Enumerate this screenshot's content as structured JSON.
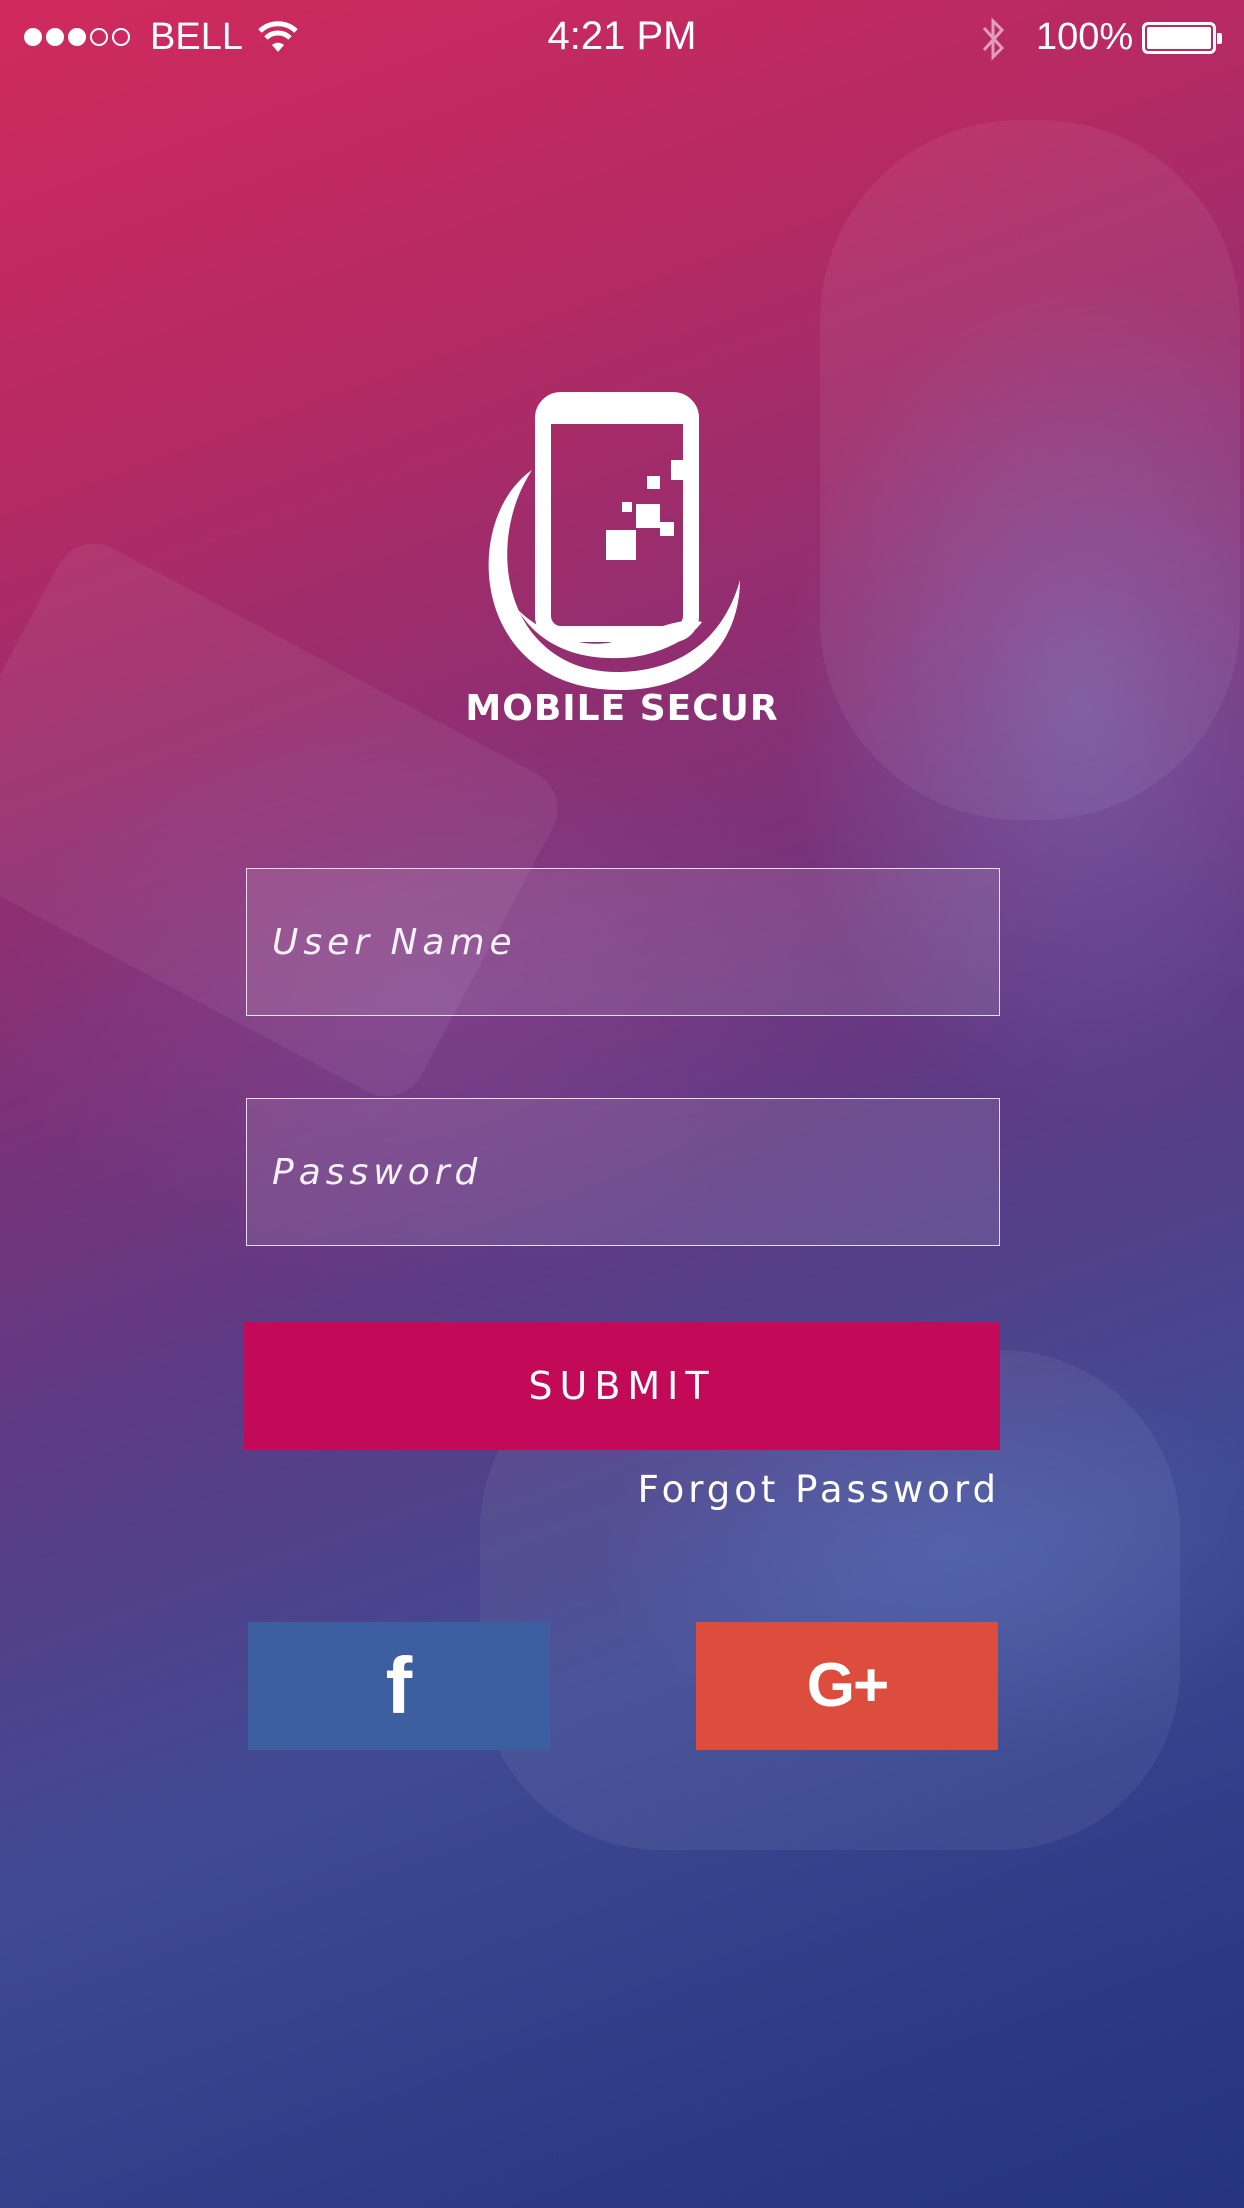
{
  "status_bar": {
    "signal": [
      true,
      true,
      true,
      false,
      false
    ],
    "carrier": "BELL",
    "time": "4:21 PM",
    "battery_percent": "100%",
    "battery_level": 1.0,
    "icons": [
      "wifi-icon",
      "bluetooth-icon",
      "battery-icon"
    ]
  },
  "brand": {
    "name": "MOBILE SECUR",
    "logo_icon": "phone-hand-shield-icon"
  },
  "login_form": {
    "username_placeholder": "User Name",
    "password_placeholder": "Password",
    "submit_label": "SUBMIT",
    "forgot_label": "Forgot Password"
  },
  "social_login": {
    "facebook_glyph": "f",
    "facebook_color": "#3d5fa2",
    "google_glyph": "G+",
    "google_color": "#dc4d3d"
  },
  "colors": {
    "accent": "#c20a58",
    "background_top": "#d02a5d",
    "background_bottom": "#253480"
  }
}
